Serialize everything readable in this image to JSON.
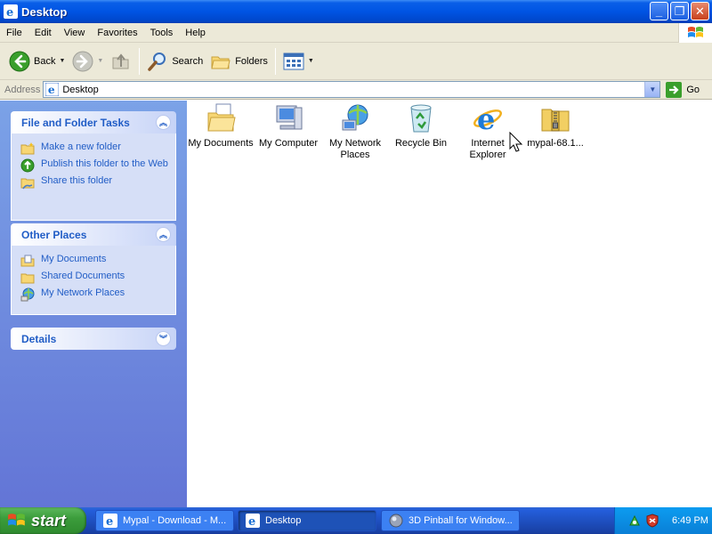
{
  "window": {
    "title": "Desktop"
  },
  "menu": [
    "File",
    "Edit",
    "View",
    "Favorites",
    "Tools",
    "Help"
  ],
  "toolbar": {
    "back": "Back",
    "search": "Search",
    "folders": "Folders"
  },
  "address": {
    "label": "Address",
    "value": "Desktop",
    "go": "Go"
  },
  "taskpane": {
    "file_tasks": {
      "title": "File and Folder Tasks",
      "items": [
        "Make a new folder",
        "Publish this folder to the Web",
        "Share this folder"
      ]
    },
    "other_places": {
      "title": "Other Places",
      "items": [
        "My Documents",
        "Shared Documents",
        "My Network Places"
      ]
    },
    "details": {
      "title": "Details"
    }
  },
  "desktop_items": [
    {
      "label": "My Documents",
      "icon": "my-documents-icon"
    },
    {
      "label": "My Computer",
      "icon": "my-computer-icon"
    },
    {
      "label": "My Network Places",
      "icon": "network-places-icon"
    },
    {
      "label": "Recycle Bin",
      "icon": "recycle-bin-icon"
    },
    {
      "label": "Internet Explorer",
      "icon": "internet-explorer-icon"
    },
    {
      "label": "mypal-68.1...",
      "icon": "zip-folder-icon"
    }
  ],
  "taskbar": {
    "start": "start",
    "tasks": [
      "Mypal - Download - M...",
      "Desktop",
      "3D Pinball for Window..."
    ],
    "clock": "6:49 PM"
  },
  "colors": {
    "titlebar": "#0054e3",
    "taskpane": "#6f8fde",
    "link": "#215dc6",
    "start": "#3c9d3c"
  }
}
